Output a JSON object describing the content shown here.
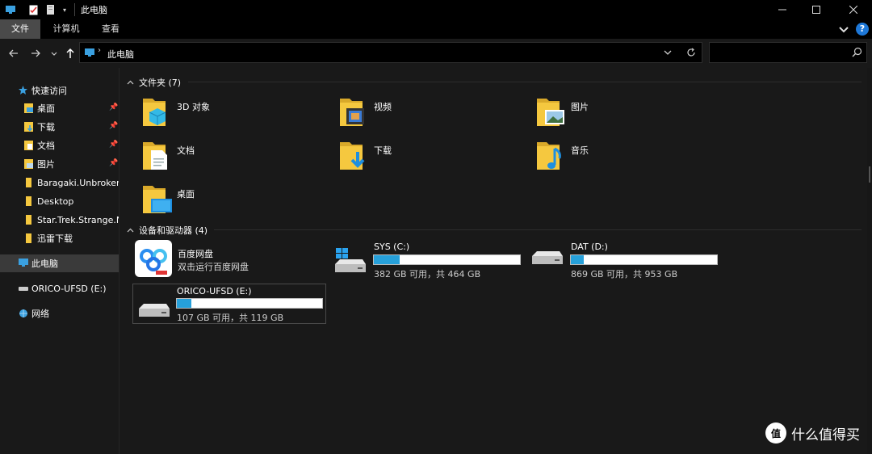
{
  "window": {
    "title": "此电脑",
    "controls": [
      "minimize-icon",
      "maximize-icon",
      "close-icon"
    ]
  },
  "ribbon": {
    "tabs": [
      "文件",
      "计算机",
      "查看"
    ],
    "active_tab": "文件"
  },
  "address": {
    "path": "此电脑"
  },
  "search": {
    "placeholder": ""
  },
  "sidebar": {
    "quick_access": "快速访问",
    "items": [
      {
        "label": "桌面",
        "pinned": true
      },
      {
        "label": "下载",
        "pinned": true
      },
      {
        "label": "文档",
        "pinned": true
      },
      {
        "label": "图片",
        "pinned": true
      },
      {
        "label": "Baragaki.Unbroken",
        "pinned": false
      },
      {
        "label": "Desktop",
        "pinned": false
      },
      {
        "label": "Star.Trek.Strange.New",
        "pinned": false
      },
      {
        "label": "迅雷下载",
        "pinned": false
      }
    ],
    "this_pc": "此电脑",
    "usb_drive": "ORICO-UFSD (E:)",
    "network": "网络"
  },
  "folders_group": {
    "title": "文件夹 (7)",
    "items": [
      {
        "label": "3D 对象",
        "icon": "3d-objects-folder-icon"
      },
      {
        "label": "视频",
        "icon": "videos-folder-icon"
      },
      {
        "label": "图片",
        "icon": "pictures-folder-icon"
      },
      {
        "label": "文档",
        "icon": "documents-folder-icon"
      },
      {
        "label": "下载",
        "icon": "downloads-folder-icon"
      },
      {
        "label": "音乐",
        "icon": "music-folder-icon"
      },
      {
        "label": "桌面",
        "icon": "desktop-folder-icon"
      }
    ]
  },
  "devices_group": {
    "title": "设备和驱动器 (4)",
    "baidu": {
      "name": "百度网盘",
      "subtitle": "双击运行百度网盘"
    },
    "drives": [
      {
        "name": "SYS (C:)",
        "free": "382 GB 可用，共 464 GB",
        "used_fraction": 0.177
      },
      {
        "name": "DAT (D:)",
        "free": "869 GB 可用，共 953 GB",
        "used_fraction": 0.088
      },
      {
        "name": "ORICO-UFSD (E:)",
        "free": "107 GB 可用，共 119 GB",
        "used_fraction": 0.101
      }
    ]
  },
  "watermark": {
    "badge": "值",
    "text": "什么值得买"
  },
  "colors": {
    "accent": "#26a0da",
    "background": "#191919",
    "folder": "#f5c83f"
  }
}
